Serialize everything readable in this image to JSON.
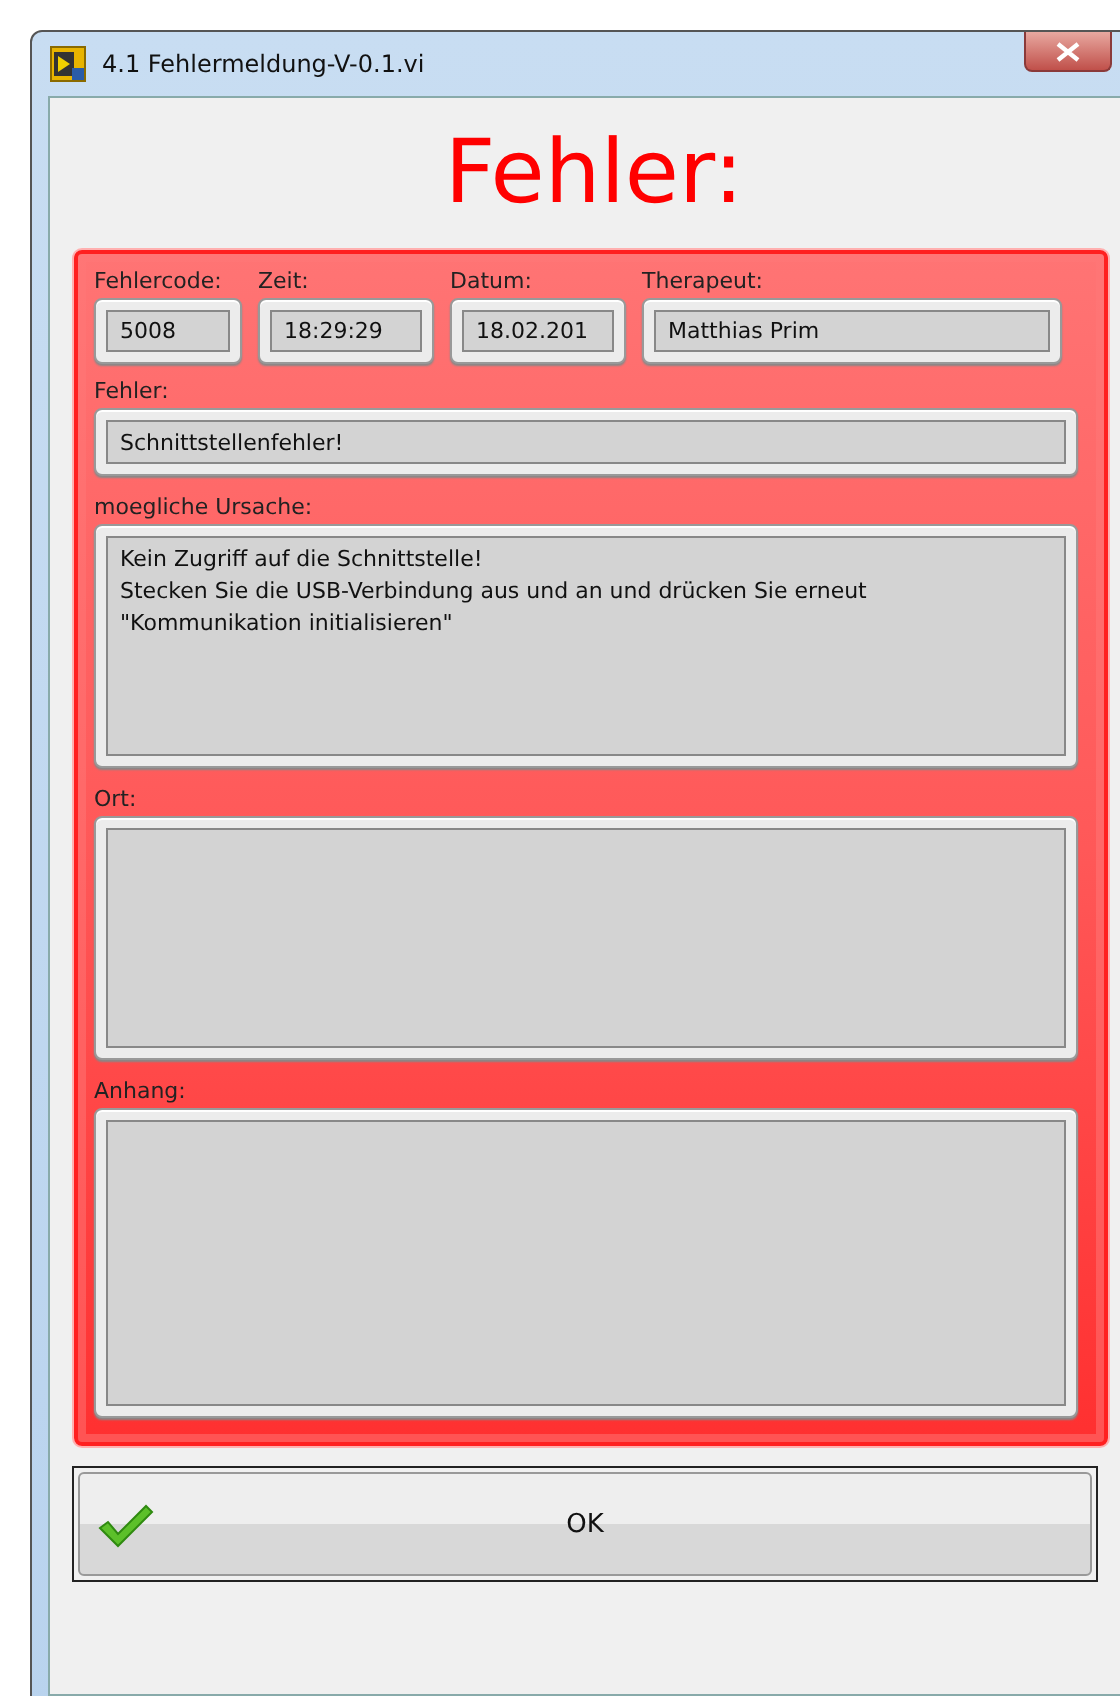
{
  "window": {
    "title": "4.1 Fehlermeldung-V-0.1.vi"
  },
  "heading": "Fehler:",
  "top_fields": [
    {
      "label": "Fehlercode:",
      "value": "5008"
    },
    {
      "label": "Zeit:",
      "value": "18:29:29"
    },
    {
      "label": "Datum:",
      "value": "18.02.201"
    },
    {
      "label": "Therapeut:",
      "value": "Matthias Prim"
    }
  ],
  "fields": [
    {
      "label": "Fehler:",
      "kind": "single",
      "value": "Schnittstellenfehler!"
    },
    {
      "label": "moegliche Ursache:",
      "kind": "multi",
      "value": "Kein Zugriff auf die Schnittstelle!\nStecken Sie die USB-Verbindung aus und an und drücken Sie erneut \"Kommunikation initialisieren\""
    },
    {
      "label": "Ort:",
      "kind": "multi"
    },
    {
      "label": "Anhang:",
      "kind": "tall"
    }
  ],
  "ok_button": {
    "label": "OK"
  }
}
